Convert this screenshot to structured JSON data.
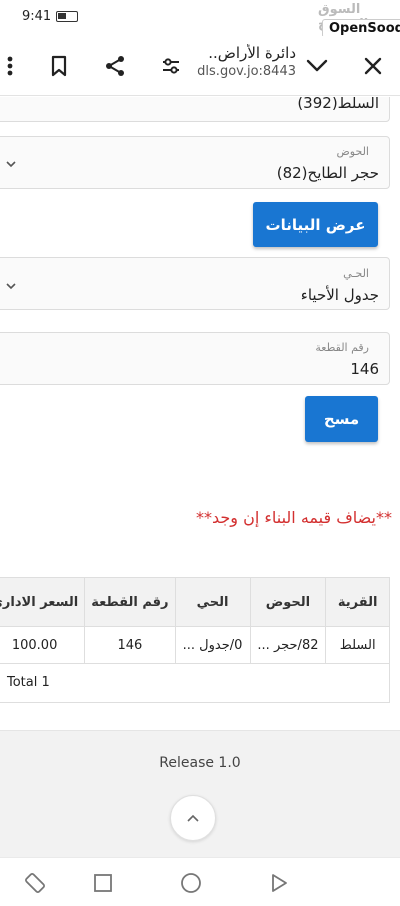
{
  "status": {
    "time": "9:41"
  },
  "watermark": {
    "brand": "OpenSooq",
    "brand_ar": "السوق المفتوح"
  },
  "browser": {
    "title": "دائرة الأراض..",
    "domain": "dls.gov.jo:8443",
    "icons": [
      "close-icon",
      "chevron-down-icon",
      "tune-icon",
      "share-icon",
      "bookmark-icon",
      "more-vert-icon"
    ]
  },
  "form": {
    "village_value": "السلط(392)",
    "basin": {
      "label": "الحوض",
      "value": "حجر الطايح(82)"
    },
    "show_button": "عرض البيانات",
    "neighborhood": {
      "label": "الحـي",
      "value": "جدول الأحياء"
    },
    "parcel": {
      "label": "رقم القطعة",
      "value": "146"
    },
    "clear_button": "مسح"
  },
  "note": "**يضاف قيمه البناء إن وجد**",
  "table": {
    "headers": {
      "village": "القرية",
      "basin": "الحوض",
      "neighborhood": "الحي",
      "parcel": "رقم القطعة",
      "price": "السعر الاداري"
    },
    "row": {
      "village": "السلط",
      "basin": "82/حجر ...",
      "neighborhood": "0/جدول ...",
      "parcel": "146",
      "price": "100.00"
    },
    "total": "Total 1"
  },
  "footer": {
    "release": "Release 1.0"
  },
  "colors": {
    "primary": "#1976d2",
    "note": "#d32f2f",
    "footer_bg": "#f2f2f2"
  }
}
